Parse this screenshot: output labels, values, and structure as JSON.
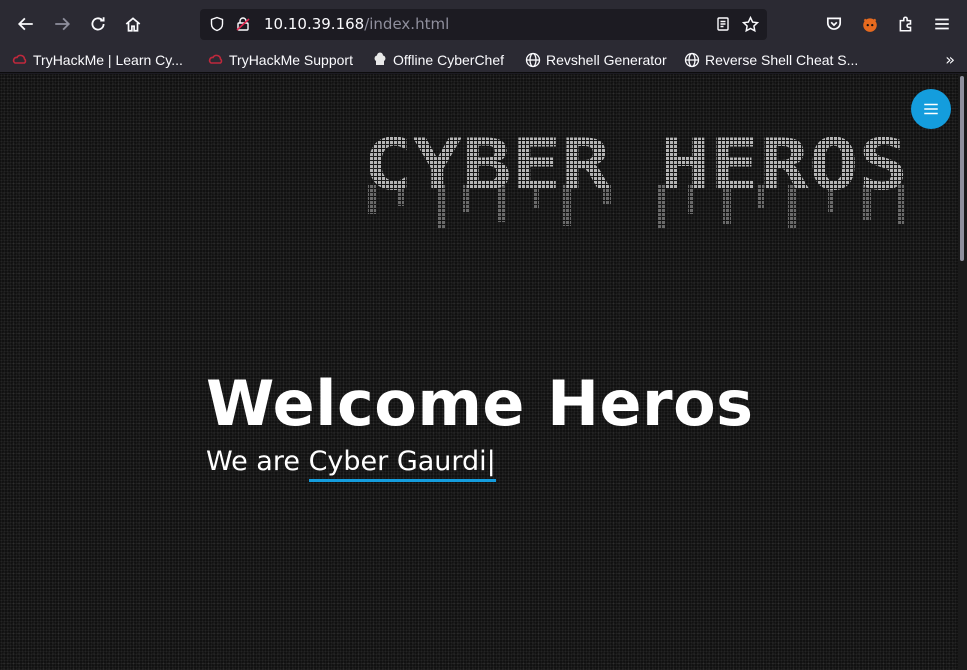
{
  "browser": {
    "url_host": "10.10.39.168",
    "url_path": "/index.html",
    "icons": [
      "back-arrow-icon",
      "forward-arrow-icon",
      "reload-icon",
      "home-icon",
      "shield-icon",
      "lock-icon",
      "reader-view-icon",
      "star-icon",
      "pocket-icon",
      "extension-fox-icon",
      "puzzle-icon",
      "hamburger-menu-icon"
    ]
  },
  "bookmarks": [
    {
      "label": "TryHackMe | Learn Cy...",
      "icon": "tryhackme-icon"
    },
    {
      "label": "TryHackMe Support",
      "icon": "tryhackme-icon"
    },
    {
      "label": "Offline CyberChef",
      "icon": "chef-hat-icon"
    },
    {
      "label": "Revshell Generator",
      "icon": "globe-icon"
    },
    {
      "label": "Reverse Shell Cheat S...",
      "icon": "globe-icon"
    }
  ],
  "page": {
    "logo_alt": "CYBER HEROS",
    "title": "Welcome Heros",
    "subtitle_prefix": "We are ",
    "subtitle_typed": "Cyber Gaurdi|",
    "accent_color": "#149ddd"
  }
}
